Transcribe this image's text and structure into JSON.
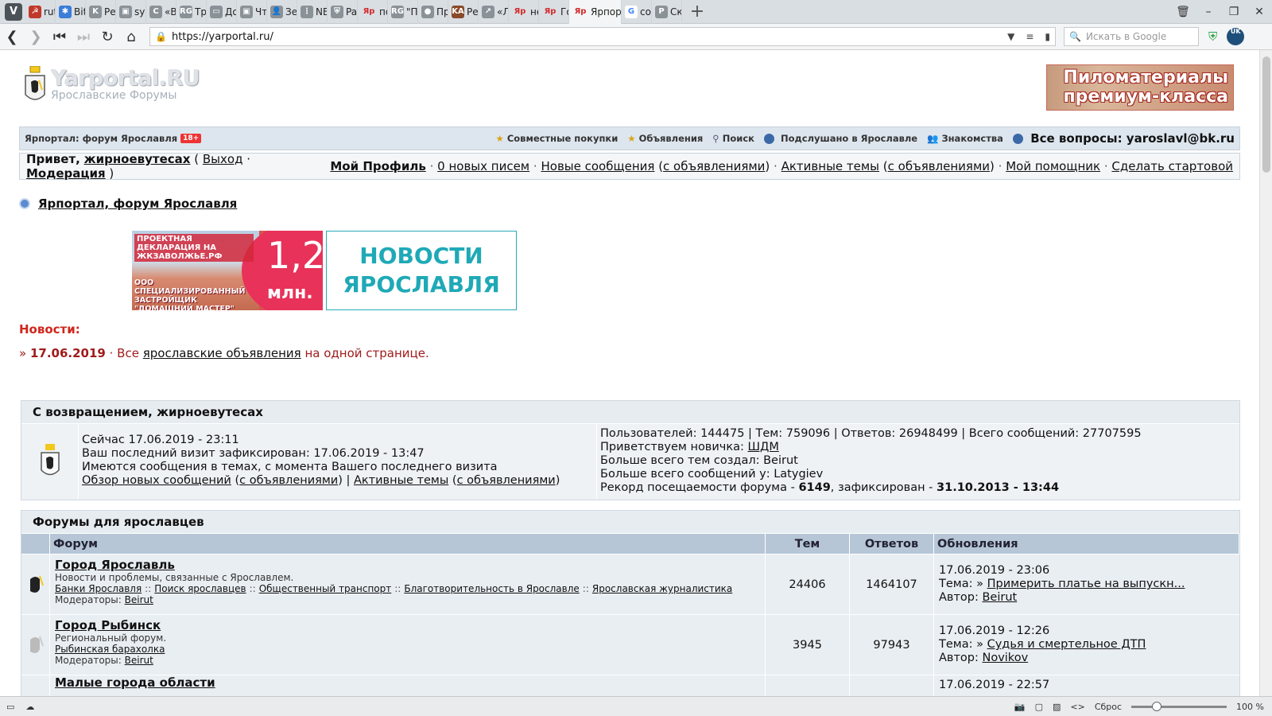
{
  "browser": {
    "tabs": [
      {
        "label": "rutor.i",
        "icon": "sickle-icon"
      },
      {
        "label": "BitTor",
        "icon": "puzzle-icon"
      },
      {
        "label": "Рецен",
        "icon": "k-icon"
      },
      {
        "label": "synth",
        "icon": "image-icon"
      },
      {
        "label": "«Восх",
        "icon": "c-icon"
      },
      {
        "label": "Трейл",
        "icon": "rg-icon"
      },
      {
        "label": "Дома",
        "icon": "tv-icon"
      },
      {
        "label": "Что д",
        "icon": "image-icon"
      },
      {
        "label": "Зерка",
        "icon": "user-icon"
      },
      {
        "label": "NEWS",
        "icon": "dots-icon"
      },
      {
        "label": "Palad",
        "icon": "shield-icon"
      },
      {
        "label": "посов",
        "icon": "yar-icon"
      },
      {
        "label": "\"Пира",
        "icon": "rg-icon"
      },
      {
        "label": "Прем",
        "icon": "bulb-icon"
      },
      {
        "label": "Рецен",
        "icon": "ka-icon"
      },
      {
        "label": "«Лицо",
        "icon": "arrow-icon"
      },
      {
        "label": "некор",
        "icon": "yar-icon"
      },
      {
        "label": "Город",
        "icon": "yar-icon"
      },
      {
        "label": "Ярпор",
        "icon": "yar-icon",
        "active": true
      },
      {
        "label": "сохра",
        "icon": "google-icon"
      },
      {
        "label": "Скрин",
        "icon": "p-icon"
      }
    ],
    "url": "https://yarportal.ru/",
    "search_placeholder": "Искать в Google",
    "zoom": "100 %",
    "reset_label": "Сброс"
  },
  "header": {
    "logo_title": "Yarportal.RU",
    "logo_sub": "Ярославские Форумы",
    "banner_line1": "Пиломатериалы",
    "banner_line2": "премиум-класса"
  },
  "topbar": {
    "site_name": "Ярпортал: форум Ярославля",
    "age_badge": "18+",
    "links": [
      "Совместные покупки",
      "Объявления",
      "Поиск",
      "Подслушано в Ярославле",
      "Знакомства"
    ],
    "contact": "Все вопросы: yaroslavl@bk.ru"
  },
  "userbar": {
    "greeting": "Привет,",
    "username": "жирноевутесах",
    "logout": "Выход",
    "moderation": "Модерация",
    "profile": "Мой Профиль",
    "messages": "0 новых писем",
    "new_posts": "Новые сообщения",
    "with_ads": "с объявлениями",
    "active_topics": "Активные темы",
    "with_ads2": "с объявлениями",
    "helper": "Мой помощник",
    "set_home": "Сделать стартовой"
  },
  "breadcrumb": "Ярпортал, форум Ярославля",
  "ads": {
    "ad1_top": "ПРОЕКТНАЯ ДЕКЛАРАЦИЯ НА ЖКЗАВОЛЖЬЕ.РФ",
    "ad1_bottom": "ООО СПЕЦИАЛИЗИРОВАННЫЙ ЗАСТРОЙЩИК \"ДОМАШНИЙ МАСТЕР\"",
    "ad1_big": "1,2",
    "ad1_unit": "млн.",
    "ad2_line1": "НОВОСТИ",
    "ad2_line2": "ЯРОСЛАВЛЯ"
  },
  "news": {
    "heading": "Новости:",
    "date": "17.06.2019",
    "text_pre": "Все",
    "link": "ярославские объявления",
    "text_post": "на одной странице."
  },
  "welcome": {
    "title": "С возвращением, жирноевутесах",
    "now": "Сейчас 17.06.2019 - 23:11",
    "last_visit": "Ваш последний визит зафиксирован: 17.06.2019 - 13:47",
    "has_posts": "Имеются сообщения в темах, с момента Вашего последнего визита",
    "review_new": "Обзор новых сообщений",
    "with_ads": "с объявлениями",
    "active_topics": "Активные темы",
    "with_ads2": "с объявлениями",
    "stats": "Пользователей: 144475 | Тем: 759096 | Ответов: 26948499 | Всего сообщений: 27707595",
    "newbie_label": "Приветствуем новичка:",
    "newbie": "ШДМ",
    "most_topics": "Больше всего тем создал: Beirut",
    "most_posts": "Больше всего сообщений у: Latygiev",
    "record_pre": "Рекорд посещаемости форума -",
    "record_count": "6149",
    "record_mid": ", зафиксирован -",
    "record_date": "31.10.2013 - 13:44"
  },
  "forums": {
    "section_title": "Форумы для ярославцев",
    "columns": {
      "forum": "Форум",
      "topics": "Тем",
      "replies": "Ответов",
      "updates": "Обновления"
    },
    "rows": [
      {
        "title": "Город Ярославль",
        "desc": "Новости и проблемы, связанные с Ярославлем.",
        "subforums": [
          "Банки Ярославля",
          "Поиск ярославцев",
          "Общественный транспорт",
          "Благотворительность в Ярославле",
          "Ярославская журналистика"
        ],
        "mod_label": "Модераторы:",
        "mod": "Beirut",
        "topics": "24406",
        "replies": "1464107",
        "upd_date": "17.06.2019 - 23:06",
        "upd_topic_label": "Тема:",
        "upd_topic": "Примерить платье на выпускн...",
        "upd_author_label": "Автор:",
        "upd_author": "Beirut"
      },
      {
        "title": "Город Рыбинск",
        "desc": "Региональный форум.",
        "subforums": [
          "Рыбинская барахолка"
        ],
        "mod_label": "Модераторы:",
        "mod": "Beirut",
        "topics": "3945",
        "replies": "97943",
        "upd_date": "17.06.2019 - 12:26",
        "upd_topic_label": "Тема:",
        "upd_topic": "Судья и смертельное ДТП",
        "upd_author_label": "Автор:",
        "upd_author": "Novikov"
      },
      {
        "title": "Малые города области",
        "upd_date": "17.06.2019 - 22:57"
      }
    ]
  }
}
